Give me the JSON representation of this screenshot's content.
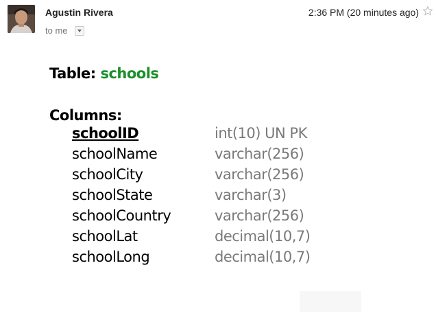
{
  "header": {
    "sender": "Agustin Rivera",
    "recipient": "to me",
    "timestamp": "2:36 PM (20 minutes ago)"
  },
  "schema": {
    "table_label": "Table:",
    "table_name": "schools",
    "columns_heading": "Columns:",
    "columns": [
      {
        "name": "schoolID",
        "type": "int(10) UN PK"
      },
      {
        "name": "schoolName",
        "type": "varchar(256)"
      },
      {
        "name": "schoolCity",
        "type": "varchar(256)"
      },
      {
        "name": "schoolState",
        "type": "varchar(3)"
      },
      {
        "name": "schoolCountry",
        "type": "varchar(256)"
      },
      {
        "name": "schoolLat",
        "type": "decimal(10,7)"
      },
      {
        "name": "schoolLong",
        "type": "decimal(10,7)"
      }
    ]
  },
  "colors": {
    "table_name": "#1a8f2a",
    "type_text": "#7a7a7a",
    "sender": "#222222",
    "recipient": "#777777"
  },
  "icons": {
    "avatar": "avatar-photo",
    "dropdown": "chevron-down-icon",
    "star": "star-icon"
  }
}
